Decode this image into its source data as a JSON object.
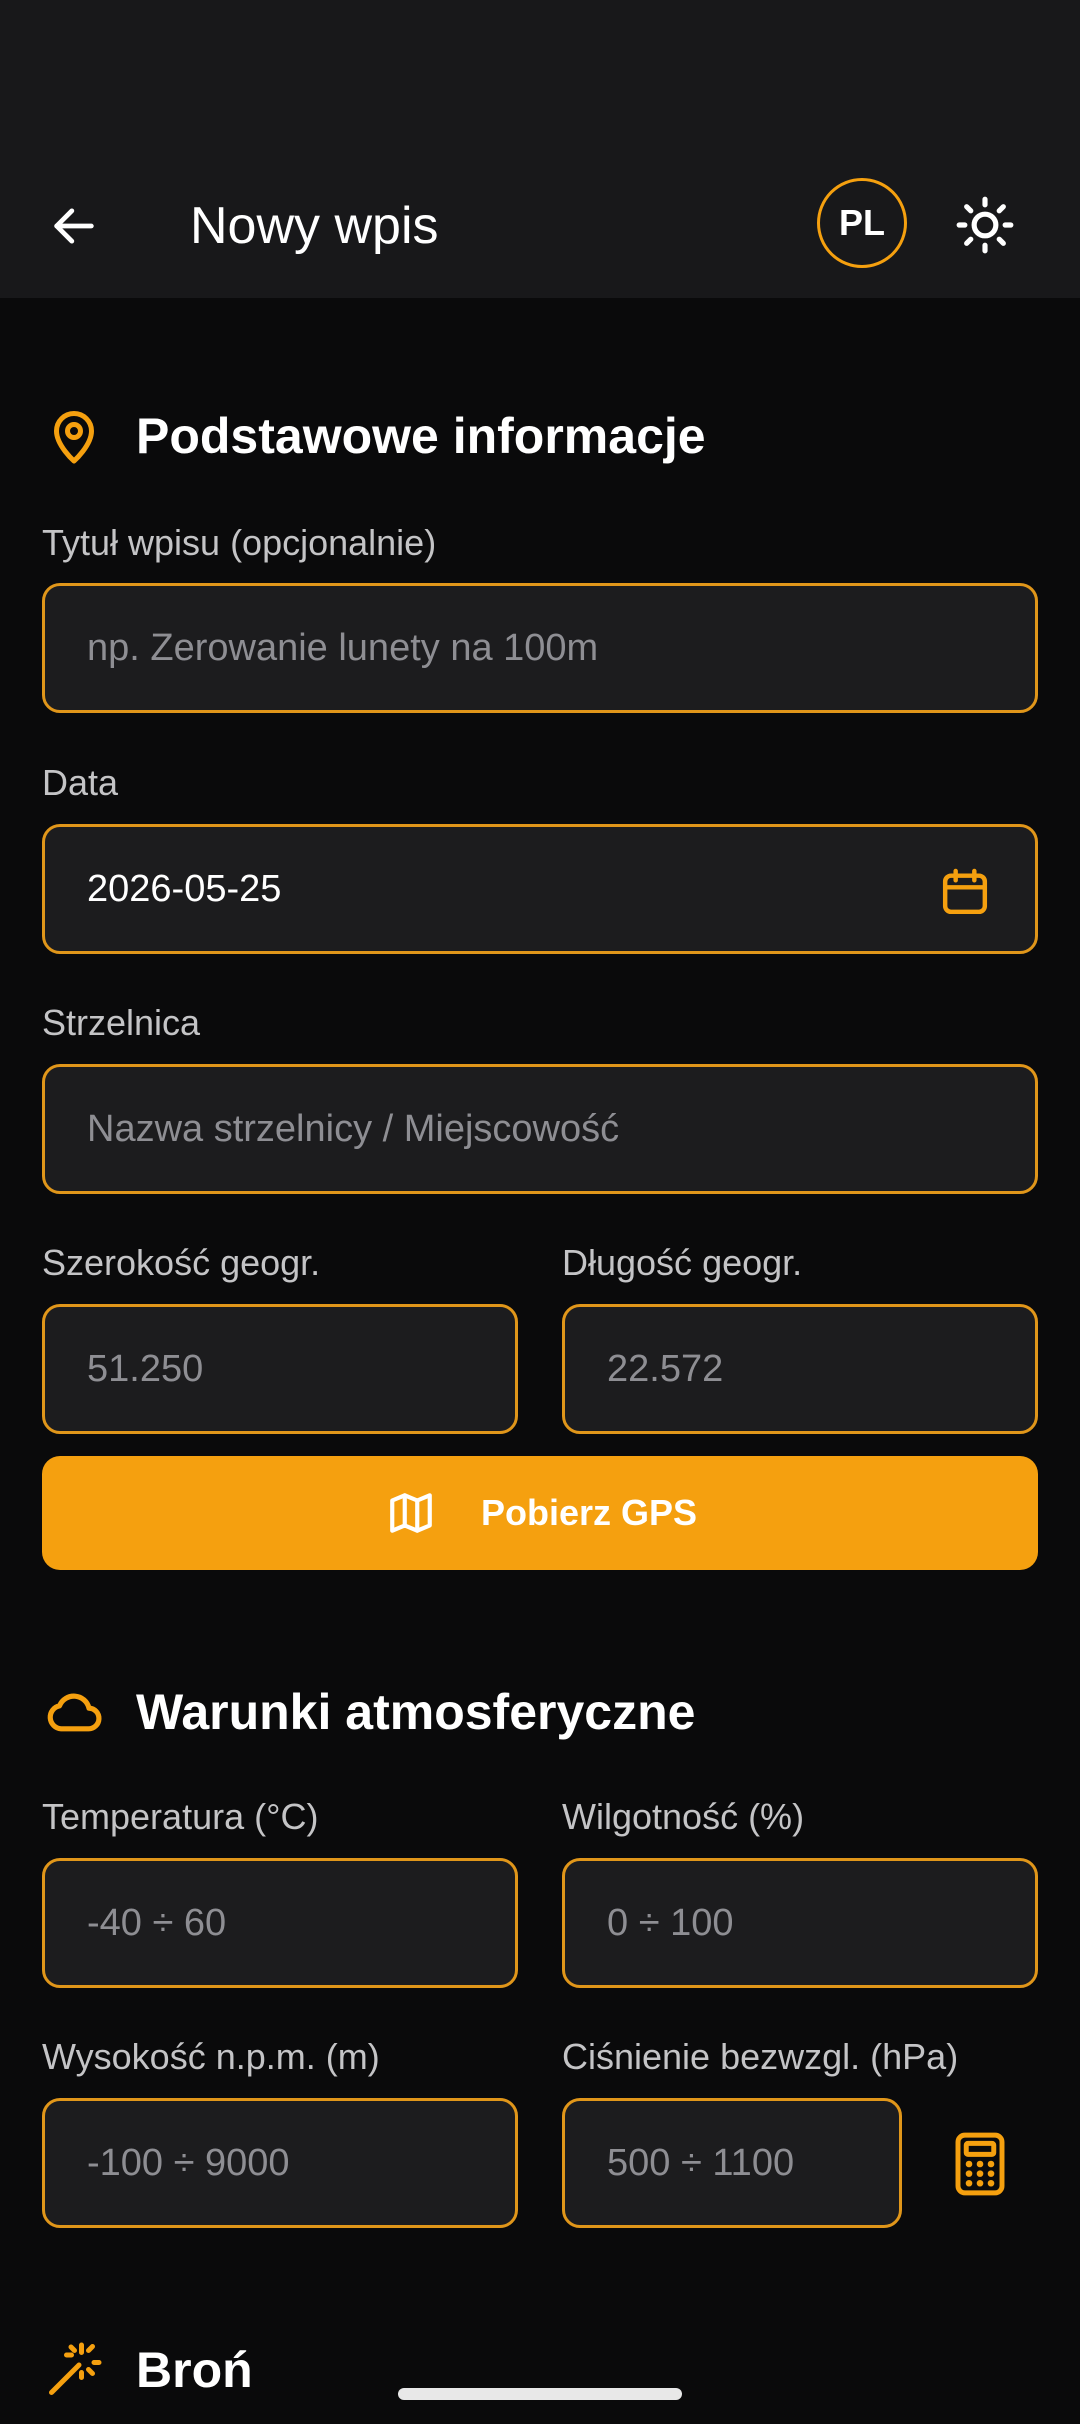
{
  "appbar": {
    "title": "Nowy wpis",
    "lang_label": "PL"
  },
  "sections": {
    "basic": {
      "title": "Podstawowe informacje"
    },
    "weather": {
      "title": "Warunki atmosferyczne"
    },
    "weapon": {
      "title": "Broń"
    }
  },
  "basic": {
    "title_label": "Tytuł wpisu (opcjonalnie)",
    "title_placeholder": "np. Zerowanie lunety na 100m",
    "date_label": "Data",
    "date_value": "2026-05-25",
    "range_label": "Strzelnica",
    "range_placeholder": "Nazwa strzelnicy / Miejscowość",
    "lat_label": "Szerokość geogr.",
    "lat_placeholder": "51.250",
    "lon_label": "Długość geogr.",
    "lon_placeholder": "22.572",
    "gps_button": "Pobierz GPS"
  },
  "weather": {
    "temp_label": "Temperatura (°C)",
    "temp_placeholder": "-40 ÷ 60",
    "humidity_label": "Wilgotność (%)",
    "humidity_placeholder": "0 ÷ 100",
    "altitude_label": "Wysokość n.p.m. (m)",
    "altitude_placeholder": "-100 ÷ 9000",
    "pressure_label": "Ciśnienie bezwzgl. (hPa)",
    "pressure_placeholder": "500 ÷ 1100"
  },
  "colors": {
    "accent": "#f5a00f",
    "background": "#0a0a0b",
    "surface": "#1c1c1e"
  },
  "icons": [
    "arrow-left-icon",
    "sun-icon",
    "map-pin-icon",
    "calendar-icon",
    "map-icon",
    "cloud-icon",
    "calculator-icon",
    "magic-wand-icon"
  ]
}
